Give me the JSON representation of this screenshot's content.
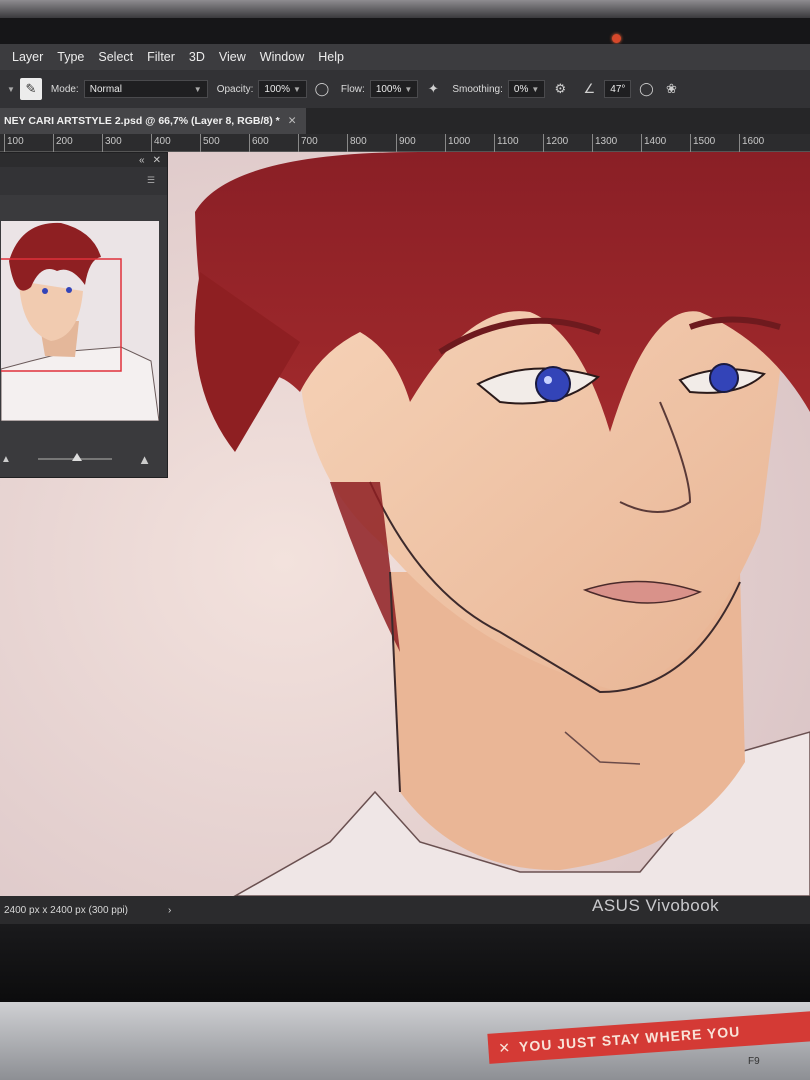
{
  "menu": [
    "Layer",
    "Type",
    "Select",
    "Filter",
    "3D",
    "View",
    "Window",
    "Help"
  ],
  "options": {
    "mode_label": "Mode:",
    "mode_value": "Normal",
    "opacity_label": "Opacity:",
    "opacity_value": "100%",
    "flow_label": "Flow:",
    "flow_value": "100%",
    "smoothing_label": "Smoothing:",
    "smoothing_value": "0%",
    "angle_value": "47°"
  },
  "document": {
    "tab_title": "NEY CARI ARTSTYLE 2.psd @ 66,7% (Layer 8, RGB/8) *"
  },
  "ruler": [
    "100",
    "200",
    "300",
    "400",
    "500",
    "600",
    "700",
    "800",
    "900",
    "1000",
    "1100",
    "1200",
    "1300",
    "1400",
    "1500",
    "1600"
  ],
  "status": {
    "doc_size": "2400 px x 2400 px (300 ppi)"
  },
  "device": {
    "brand": "ASUS Vivobook",
    "sticker_text": "YOU JUST STAY WHERE YOU",
    "key_label": "F9"
  },
  "colors": {
    "hair": "#8e1f22",
    "skin": "#efc7a8",
    "iris": "#3344b8",
    "canvas_bg": "#e9d8d4",
    "sticker": "#d43a35"
  }
}
